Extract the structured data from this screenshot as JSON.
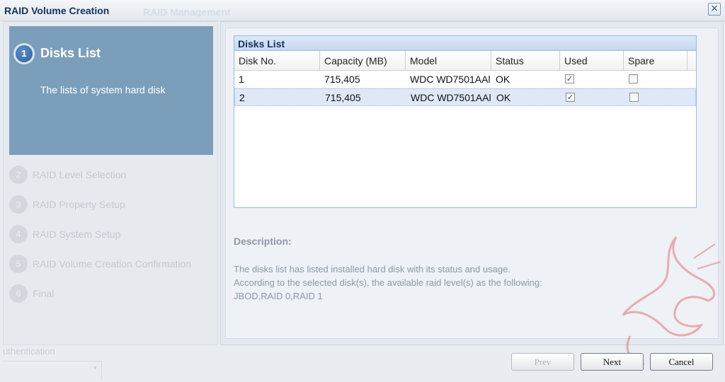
{
  "window": {
    "title": "RAID Volume Creation",
    "background_title": "RAID Management",
    "close_label": "×"
  },
  "wizard": {
    "active": {
      "number": "1",
      "title": "Disks List",
      "description": "The lists of system hard disk"
    },
    "steps": [
      {
        "number": "2",
        "label": "RAID Level Selection"
      },
      {
        "number": "3",
        "label": "RAID Property Setup"
      },
      {
        "number": "4",
        "label": "RAID System Setup"
      },
      {
        "number": "5",
        "label": "RAID Volume Creation Confirmation"
      },
      {
        "number": "6",
        "label": "Final"
      }
    ],
    "background_item": "uthentication"
  },
  "disks_list": {
    "title": "Disks List",
    "columns": [
      "Disk No.",
      "Capacity (MB)",
      "Model",
      "Status",
      "Used",
      "Spare"
    ],
    "rows": [
      {
        "disk_no": "1",
        "capacity": "715,405",
        "model": "WDC WD7501AAl",
        "status": "OK",
        "used": true,
        "spare": false
      },
      {
        "disk_no": "2",
        "capacity": "715,405",
        "model": "WDC WD7501AAl",
        "status": "OK",
        "used": true,
        "spare": false
      }
    ],
    "selected_row": 2
  },
  "description": {
    "title": "Description:",
    "lines": [
      "The disks list has listed installed hard disk with its status and usage.",
      "According to the selected disk(s), the available raid level(s) as the following:",
      "JBOD,RAID 0,RAID 1"
    ]
  },
  "buttons": {
    "prev": "Prev",
    "next": "Next",
    "cancel": "Cancel"
  },
  "colors": {
    "active_step_bg": "#7b9fbb",
    "header_text": "#15315a",
    "muted_text": "#8c9aab"
  }
}
